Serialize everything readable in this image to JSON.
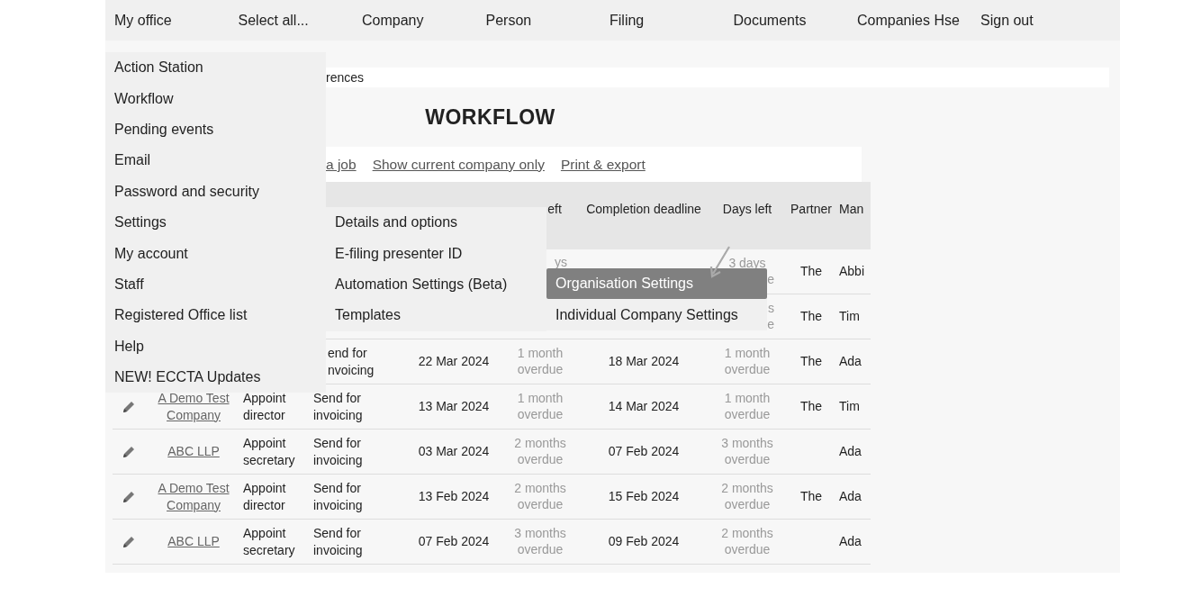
{
  "nav": [
    "My office",
    "Select all...",
    "Company",
    "Person",
    "Filing",
    "Documents",
    "Companies Hse",
    "Sign out"
  ],
  "breadcrumb": "rences",
  "title": "WORKFLOW",
  "actions": [
    "a job",
    "Show current company only",
    "Print & export"
  ],
  "table": {
    "columns": {
      "days_left": "eft",
      "completion_deadline": "Completion deadline",
      "days_left_2": "Days left",
      "partner": "Partner",
      "column_10": "Man"
    },
    "rows": [
      {
        "overdue_end": "ys",
        "days_left": "3 days",
        "days_left_end": "e",
        "partner": "The",
        "manager": "Abbi"
      },
      {
        "days_left_end": "s\ne",
        "partner": "The",
        "manager": "Tim"
      },
      {
        "status": "end for\nnvoicing",
        "date": "22 Mar 2024",
        "overdue": "1 month\noverdue",
        "deadline": "18 Mar 2024",
        "days_left": "1 month\noverdue",
        "partner": "The",
        "manager": "Ada"
      },
      {
        "company": "A Demo Test\nCompany",
        "action": "Appoint\ndirector",
        "status": "Send for\ninvoicing",
        "date": "13 Mar 2024",
        "overdue": "1 month\noverdue",
        "deadline": "14 Mar 2024",
        "days_left": "1 month\noverdue",
        "partner": "The",
        "manager": "Tim"
      },
      {
        "company": "ABC LLP",
        "action": "Appoint\nsecretary",
        "status": "Send for\ninvoicing",
        "date": "03 Mar 2024",
        "overdue": "2 months\noverdue",
        "deadline": "07 Feb 2024",
        "days_left": "3 months\noverdue",
        "manager": "Ada"
      },
      {
        "company": "A Demo Test\nCompany",
        "action": "Appoint\ndirector",
        "status": "Send for\ninvoicing",
        "date": "13 Feb 2024",
        "overdue": "2 months\noverdue",
        "deadline": "15 Feb 2024",
        "days_left": "2 months\noverdue",
        "partner": "The",
        "manager": "Ada"
      },
      {
        "company": "ABC LLP",
        "action": "Appoint\nsecretary",
        "status": "Send for\ninvoicing",
        "date": "07 Feb 2024",
        "overdue": "3 months\noverdue",
        "deadline": "09 Feb 2024",
        "days_left": "2 months\noverdue",
        "manager": "Ada"
      }
    ]
  },
  "menu": {
    "items": [
      "Action Station",
      "Workflow",
      "Pending events",
      "Email",
      "Password and security",
      "Settings",
      "My account",
      "Staff",
      "Registered Office list",
      "Help",
      "NEW! ECCTA Updates"
    ]
  },
  "submenu": {
    "items": [
      "Details and options",
      "E-filing presenter ID",
      "Automation Settings (Beta)",
      "Templates"
    ]
  },
  "settings_menu": {
    "items": [
      {
        "label": "Organisation Settings",
        "selected": true
      },
      {
        "label": "Individual Company Settings",
        "selected": false
      }
    ]
  }
}
